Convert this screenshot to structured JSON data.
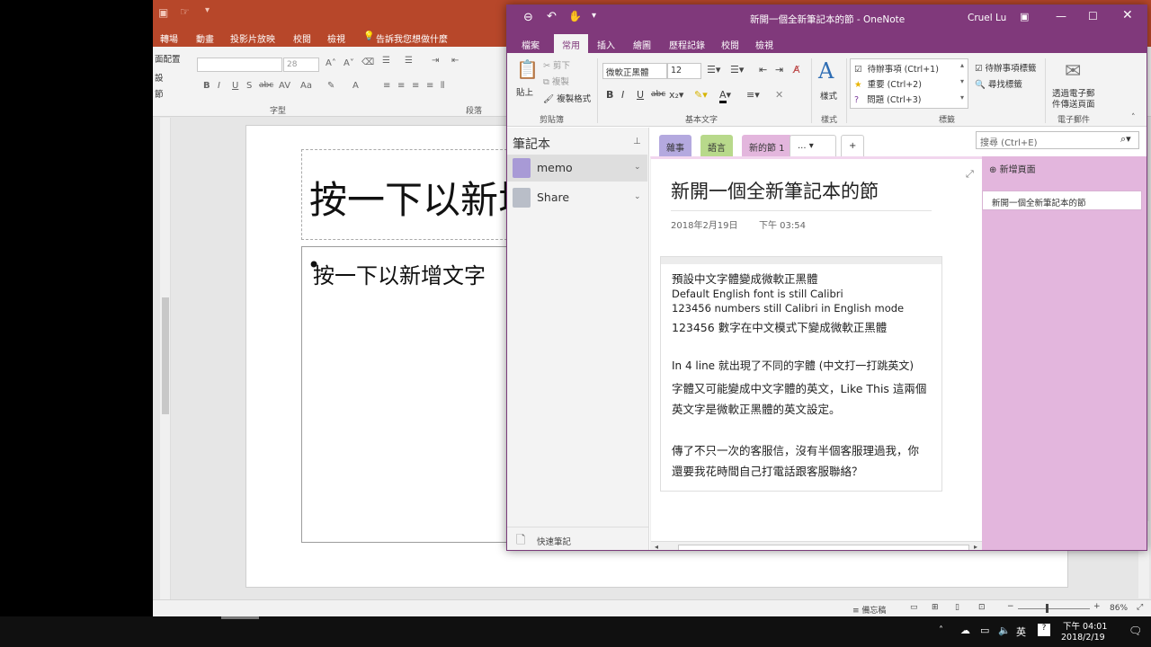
{
  "powerpoint": {
    "tabs": [
      "轉場",
      "動畫",
      "投影片放映",
      "校閱",
      "檢視"
    ],
    "tell_me": "告訴我您想做什麼",
    "ribbon": {
      "left_items": [
        "面配置",
        "設",
        "節"
      ],
      "font_size": "28",
      "group_font": "字型",
      "group_paragraph": "段落"
    },
    "slide": {
      "title_placeholder": "按一下以新增標題",
      "body_placeholder": "按一下以新增文字"
    },
    "status": {
      "notes": "備忘稿",
      "zoom": "86%"
    }
  },
  "onenote": {
    "window_title": "新開一個全新筆記本的節 - OneNote",
    "user": "Cruel Lu",
    "tabs": [
      "檔案",
      "常用",
      "插入",
      "繪圖",
      "歷程記錄",
      "校閱",
      "檢視"
    ],
    "ribbon": {
      "paste": "貼上",
      "cut": "剪下",
      "copy": "複製",
      "format_painter": "複製格式",
      "group_clipboard": "剪貼簿",
      "font_name": "微軟正黑體",
      "font_size": "12",
      "group_basic_text": "基本文字",
      "styles": "樣式",
      "group_styles": "樣式",
      "tags": [
        "待辦事項 (Ctrl+1)",
        "重要 (Ctrl+2)",
        "問題 (Ctrl+3)"
      ],
      "todo_tag": "待辦事項標籤",
      "find_tags": "尋找標籤",
      "group_tags": "標籤",
      "email_page_line1": "透過電子郵",
      "email_page_line2": "件傳送頁面",
      "group_email": "電子郵件"
    },
    "notebook_pane": {
      "title": "筆記本",
      "notebooks": [
        {
          "label": "memo",
          "color": "#a89ad6"
        },
        {
          "label": "Share",
          "color": "#b9bec8"
        }
      ],
      "quick_notes": "快速筆記"
    },
    "section_tabs": [
      {
        "label": "雜事",
        "color": "#b4a9df"
      },
      {
        "label": "語言",
        "color": "#b8d98b"
      },
      {
        "label": "新的節 1",
        "color": "#e3b6dd"
      },
      {
        "label": "...",
        "color": "#ffffff"
      }
    ],
    "search_placeholder": "搜尋 (Ctrl+E)",
    "page": {
      "title": "新開一個全新筆記本的節",
      "date": "2018年2月19日",
      "time": "下午 03:54",
      "lines": [
        "預設中文字體變成微軟正黑體",
        "Default English font is still Calibri",
        "123456 numbers still Calibri in English mode",
        "123456 數字在中文模式下變成微軟正黑體",
        "",
        "In 4 line 就出現了不同的字體 (中文打一打跳英文)",
        "字體又可能變成中文字體的英文，Like This 這兩個",
        "英文字是微軟正黑體的英文設定。",
        "",
        "傳了不只一次的客服信，沒有半個客服理過我，你",
        "還要我花時間自己打電話跟客服聯絡？"
      ]
    },
    "page_list": {
      "add_page": "新增頁面",
      "pages": [
        "新開一個全新筆記本的節"
      ]
    }
  },
  "taskbar": {
    "ime": "英",
    "time": "下午 04:01",
    "date": "2018/2/19"
  }
}
